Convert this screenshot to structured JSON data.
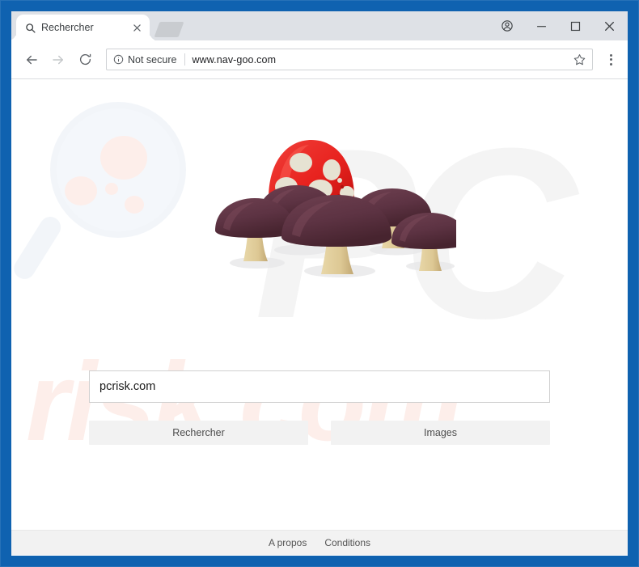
{
  "window": {
    "frame_color": "#0f62b0",
    "controls": {
      "profile": "profile-avatar-icon",
      "minimize": "–",
      "maximize": "□",
      "close": "✕"
    }
  },
  "tabstrip": {
    "tab": {
      "title": "Rechercher",
      "favicon": "search-icon",
      "close_label": "✕"
    },
    "new_tab_label": "+"
  },
  "toolbar": {
    "back_label": "←",
    "forward_label": "→",
    "reload_label": "⟳",
    "security_text": "Not secure",
    "url": "www.nav-goo.com",
    "bookmark_label": "☆",
    "menu_label": "⋮"
  },
  "page": {
    "logo_alt": "mushroom-cluster-logo",
    "watermarks": {
      "brand_upper": "PC",
      "brand_lower": "risk.com"
    },
    "search": {
      "value": "pcrisk.com",
      "placeholder": ""
    },
    "buttons": {
      "search_label": "Rechercher",
      "images_label": "Images"
    },
    "footer": {
      "links": [
        {
          "label": "A propos"
        },
        {
          "label": "Conditions"
        }
      ]
    }
  },
  "colors": {
    "frame_blue": "#0f62b0",
    "tabstrip": "#dee1e6",
    "button_bg": "#f2f2f2",
    "mushroom_red": "#e8231f",
    "mushroom_spot": "#e6e2d2",
    "mushroom_cap": "#5d3343",
    "mushroom_stem": "#ddc894",
    "watermark_gray": "#f4f4f4",
    "watermark_pink": "#fdeeea"
  }
}
